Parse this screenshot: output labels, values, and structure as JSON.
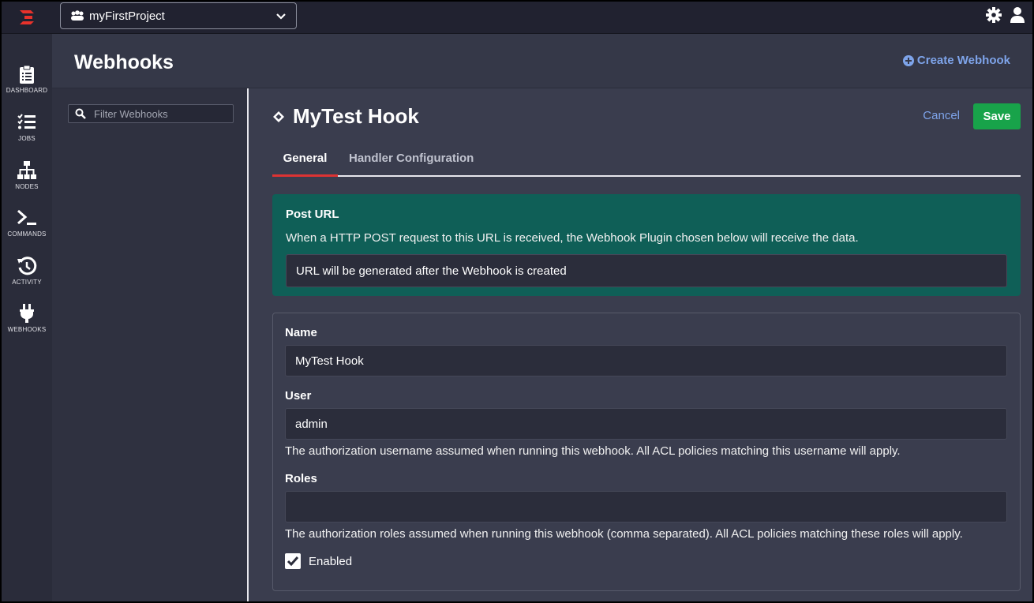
{
  "topbar": {
    "project_name": "myFirstProject"
  },
  "nav": {
    "items": [
      {
        "label": "DASHBOARD",
        "icon": "clipboard-icon"
      },
      {
        "label": "JOBS",
        "icon": "list-check-icon"
      },
      {
        "label": "NODES",
        "icon": "sitemap-icon"
      },
      {
        "label": "COMMANDS",
        "icon": "terminal-icon"
      },
      {
        "label": "ACTIVITY",
        "icon": "history-icon"
      },
      {
        "label": "WEBHOOKS",
        "icon": "plug-icon"
      }
    ]
  },
  "header": {
    "title": "Webhooks",
    "create_label": "Create Webhook"
  },
  "list": {
    "filter_placeholder": "Filter Webhooks"
  },
  "editor": {
    "hook_title": "MyTest Hook",
    "cancel_label": "Cancel",
    "save_label": "Save",
    "tabs": [
      "General",
      "Handler Configuration"
    ],
    "active_tab": "General"
  },
  "post_url": {
    "title": "Post URL",
    "description": "When a HTTP POST request to this URL is received, the Webhook Plugin chosen below will receive the data.",
    "value": "URL will be generated after the Webhook is created"
  },
  "form": {
    "name_label": "Name",
    "name_value": "MyTest Hook",
    "user_label": "User",
    "user_value": "admin",
    "user_help": "The authorization username assumed when running this webhook. All ACL policies matching this username will apply.",
    "roles_label": "Roles",
    "roles_value": "",
    "roles_help": "The authorization roles assumed when running this webhook (comma separated). All ACL policies matching these roles will apply.",
    "enabled_label": "Enabled",
    "enabled": true
  },
  "colors": {
    "accent_link": "#7ea4ea",
    "save_green": "#18a34a",
    "post_box": "#0f5f57",
    "tab_underline": "#dd3333",
    "logo_red": "#e8322b"
  }
}
